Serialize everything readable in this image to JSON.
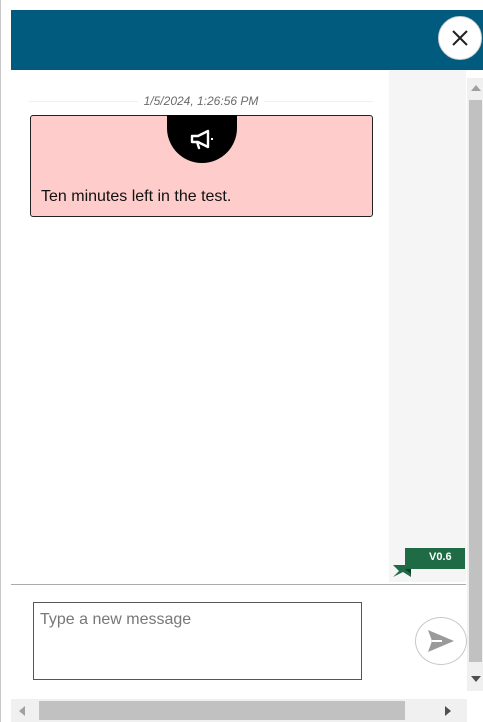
{
  "header": {
    "background": "#005b7f",
    "close_icon": "close-icon"
  },
  "messages": [
    {
      "timestamp": "1/5/2024, 1:26:56 PM",
      "type": "announcement",
      "icon": "megaphone-icon",
      "text": "Ten minutes left in the test.",
      "background": "#ffcccc"
    }
  ],
  "version": {
    "label": "V0.6",
    "color": "#1e6b46"
  },
  "composer": {
    "placeholder": "Type a new message",
    "value": "",
    "send_icon": "send-icon"
  }
}
